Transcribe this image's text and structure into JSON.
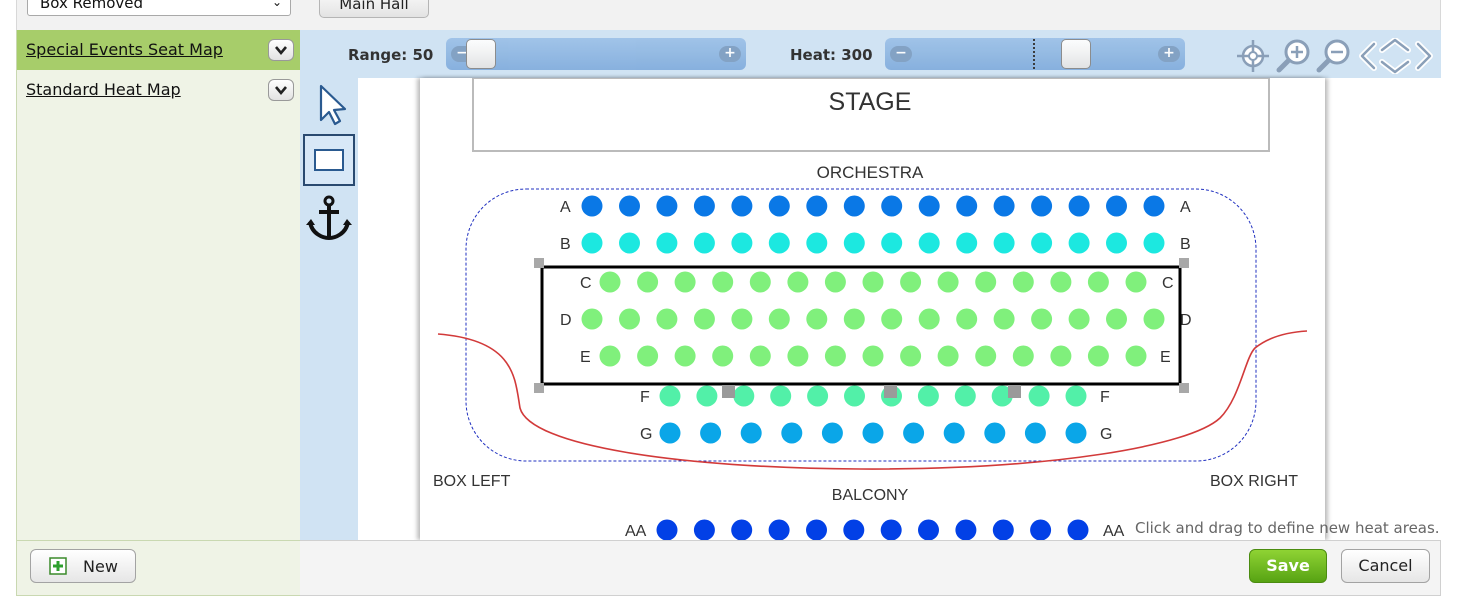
{
  "top": {
    "select_value": "Box Removed",
    "button_label": "Main Hall"
  },
  "sidebar": {
    "items": [
      {
        "label": "Special Events Seat Map",
        "active": true
      },
      {
        "label": "Standard Heat Map",
        "active": false
      }
    ],
    "new_button": "New"
  },
  "controls": {
    "range_label": "Range: 50",
    "range_value": 50,
    "heat_label": "Heat: 300",
    "heat_value": 300
  },
  "tools": [
    "pointer-icon",
    "rectangle-icon",
    "anchor-icon"
  ],
  "toolbar_icons": [
    "crosshair-icon",
    "zoom-in-icon",
    "zoom-out-icon",
    "pan-left-icon",
    "pan-up-icon",
    "pan-down-icon",
    "pan-right-icon"
  ],
  "seatmap": {
    "stage_label": "STAGE",
    "orchestra_label": "ORCHESTRA",
    "balcony_label": "BALCONY",
    "box_left_label": "BOX LEFT",
    "box_right_label": "BOX RIGHT",
    "rows": [
      {
        "name": "A",
        "seats": 16,
        "color": "#0a78e6"
      },
      {
        "name": "B",
        "seats": 16,
        "color": "#1ce8e0"
      },
      {
        "name": "C",
        "seats": 15,
        "color": "#80f07c"
      },
      {
        "name": "D",
        "seats": 16,
        "color": "#80f07c"
      },
      {
        "name": "E",
        "seats": 15,
        "color": "#80f07c"
      },
      {
        "name": "F",
        "seats": 12,
        "color": "#52f0a8"
      },
      {
        "name": "G",
        "seats": 11,
        "color": "#0aa6e8"
      },
      {
        "name": "AA",
        "seats": 12,
        "color": "#0240e6"
      }
    ]
  },
  "hint": "Click and drag to define new heat areas.",
  "footer": {
    "save_label": "Save",
    "cancel_label": "Cancel"
  },
  "colors": {
    "accent_green": "#a7cd6a",
    "save_green": "#6cba1f",
    "tool_bg": "#d0e3f3",
    "selection_red": "#d23a3a",
    "boundary_blue": "#2030c0"
  }
}
